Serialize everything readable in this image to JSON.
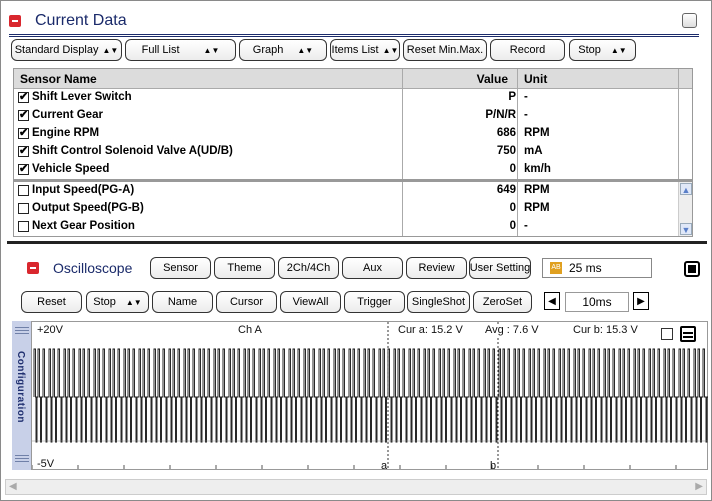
{
  "current_data": {
    "title": "Current Data",
    "toolbar": [
      "Standard Display",
      "Full List",
      "Graph",
      "Items List",
      "Reset Min.Max.",
      "Record",
      "Stop"
    ],
    "headers": {
      "name": "Sensor Name",
      "value": "Value",
      "unit": "Unit"
    },
    "fixed_rows": [
      {
        "name": "Shift Lever Switch",
        "value": "P",
        "unit": "-",
        "checked": true
      },
      {
        "name": "Current Gear",
        "value": "P/N/R",
        "unit": "-",
        "checked": true
      },
      {
        "name": "Engine RPM",
        "value": "686",
        "unit": "RPM",
        "checked": true
      },
      {
        "name": "Shift Control Solenoid Valve A(UD/B)",
        "value": "750",
        "unit": "mA",
        "checked": true
      },
      {
        "name": "Vehicle Speed",
        "value": "0",
        "unit": "km/h",
        "checked": true
      }
    ],
    "scroll_rows": [
      {
        "name": "Input Speed(PG-A)",
        "value": "649",
        "unit": "RPM",
        "checked": false
      },
      {
        "name": "Output Speed(PG-B)",
        "value": "0",
        "unit": "RPM",
        "checked": false
      },
      {
        "name": "Next Gear Position",
        "value": "0",
        "unit": "-",
        "checked": false
      }
    ]
  },
  "oscilloscope": {
    "title": "Oscilloscope",
    "toolbar1": [
      "Sensor",
      "Theme",
      "2Ch/4Ch",
      "Aux",
      "Review",
      "User Setting"
    ],
    "timebase_display": "25 ms",
    "toolbar2": [
      "Reset",
      "Stop",
      "Name",
      "Cursor",
      "ViewAll",
      "Trigger",
      "SingleShot",
      "ZeroSet"
    ],
    "time_div": "10ms",
    "config_label": "Configuration",
    "y_top": "+20V",
    "y_bottom": "-5V",
    "channel": "Ch A",
    "cur_a": "Cur a: 15.2 V",
    "avg": "Avg : 7.6 V",
    "cur_b": "Cur b: 15.3 V",
    "cursor_a_label": "a",
    "cursor_b_label": "b"
  },
  "colors": {
    "accent": "#d9272e",
    "title": "#1a2a6a",
    "config_bg": "#c8d0e8"
  }
}
